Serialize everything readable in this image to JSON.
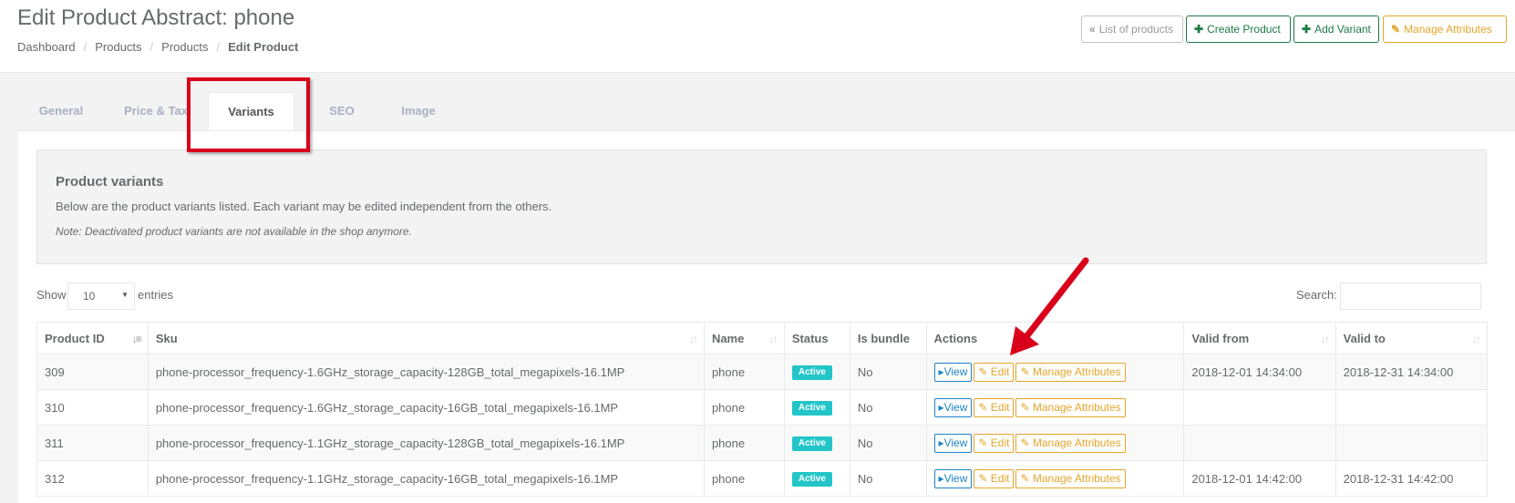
{
  "header": {
    "title": "Edit Product Abstract: phone",
    "breadcrumb": [
      "Dashboard",
      "Products",
      "Products",
      "Edit Product"
    ],
    "buttons": {
      "list": "List of products",
      "create": "Create Product",
      "add_variant": "Add Variant",
      "manage_attributes": "Manage Attributes"
    }
  },
  "tabs": [
    "General",
    "Price & Tax",
    "Variants",
    "SEO",
    "Image"
  ],
  "active_tab": "Variants",
  "info": {
    "title": "Product variants",
    "text": "Below are the product variants listed. Each variant may be edited independent from the others.",
    "note": "Note: Deactivated product variants are not available in the shop anymore."
  },
  "table_controls": {
    "show_label": "Show",
    "page_size": "10",
    "entries_label": "entries",
    "search_label": "Search:"
  },
  "table": {
    "columns": [
      "Product ID",
      "Sku",
      "Name",
      "Status",
      "Is bundle",
      "Actions",
      "Valid from",
      "Valid to"
    ],
    "actions": {
      "view": "View",
      "edit": "Edit",
      "manage": "Manage Attributes"
    },
    "rows": [
      {
        "id": "309",
        "sku": "phone-processor_frequency-1.6GHz_storage_capacity-128GB_total_megapixels-16.1MP",
        "name": "phone",
        "status": "Active",
        "bundle": "No",
        "valid_from": "2018-12-01 14:34:00",
        "valid_to": "2018-12-31 14:34:00"
      },
      {
        "id": "310",
        "sku": "phone-processor_frequency-1.6GHz_storage_capacity-16GB_total_megapixels-16.1MP",
        "name": "phone",
        "status": "Active",
        "bundle": "No",
        "valid_from": "",
        "valid_to": ""
      },
      {
        "id": "311",
        "sku": "phone-processor_frequency-1.1GHz_storage_capacity-128GB_total_megapixels-16.1MP",
        "name": "phone",
        "status": "Active",
        "bundle": "No",
        "valid_from": "",
        "valid_to": ""
      },
      {
        "id": "312",
        "sku": "phone-processor_frequency-1.1GHz_storage_capacity-16GB_total_megapixels-16.1MP",
        "name": "phone",
        "status": "Active",
        "bundle": "No",
        "valid_from": "2018-12-01 14:42:00",
        "valid_to": "2018-12-31 14:42:00"
      }
    ]
  },
  "colors": {
    "accent_green": "#1c7a45",
    "accent_orange": "#e4a52b",
    "accent_blue": "#1c84c6",
    "badge_active": "#23c6c8",
    "annotation_red": "#d9001b"
  }
}
